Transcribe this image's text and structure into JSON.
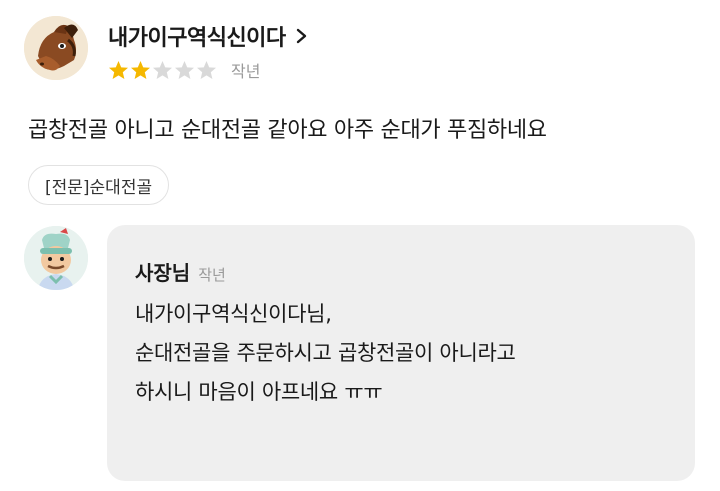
{
  "review": {
    "user_name": "내가이구역식신이다",
    "rating": 2,
    "rating_max": 5,
    "date": "작년",
    "text": "곱창전골 아니고 순대전골 같아요 아주 순대가 푸짐하네요",
    "menu_tag": "[전문]순대전골",
    "star_filled_color": "#f5b800",
    "star_empty_color": "#d9d9d9"
  },
  "reply": {
    "owner_name": "사장님",
    "date": "작년",
    "lines": [
      "내가이구역식신이다님,",
      "순대전골을 주문하시고 곱창전골이 아니라고",
      "하시니 마음이 아프네요 ㅠㅠ"
    ],
    "bubble_color": "#efefef"
  },
  "icons": {
    "user_avatar": "horse-avatar-icon",
    "owner_avatar": "chef-avatar-icon",
    "profile_link": "chevron-right-icon",
    "rating": "star-icon"
  }
}
